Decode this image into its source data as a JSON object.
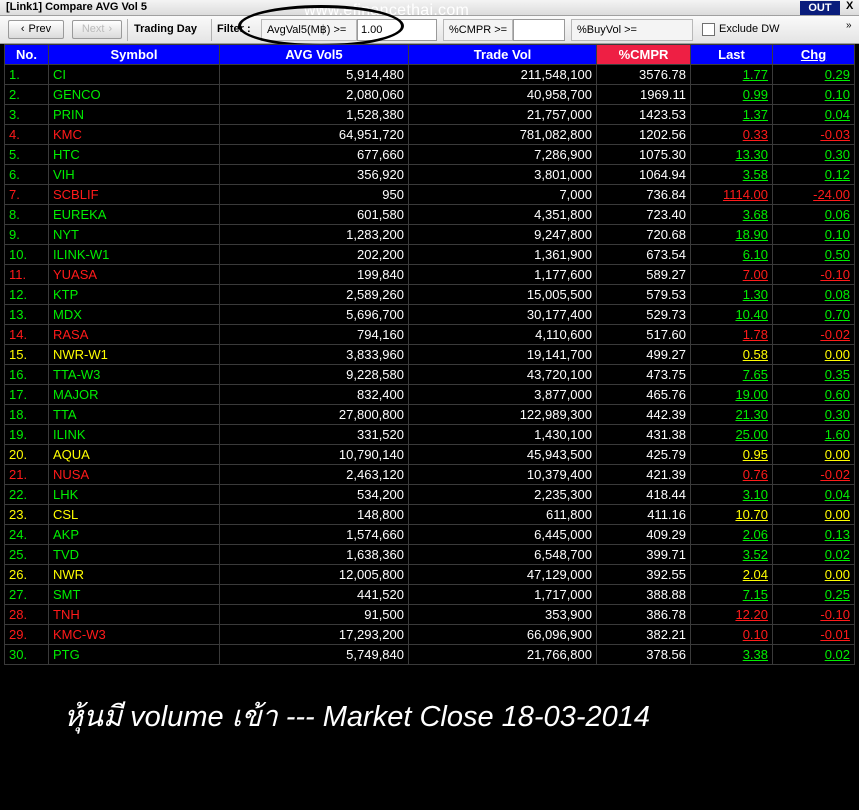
{
  "window": {
    "title": "[Link1] Compare AVG Vol 5",
    "watermark": "www.efinancethai.com",
    "out_label": "OUT",
    "close_label": "X"
  },
  "toolbar": {
    "prev_label": "Prev",
    "next_label": "Next",
    "trading_day_label": "Trading Day",
    "filter_label": "Filter :",
    "avgval_label": "AvgVal5(M฿) >=",
    "avgval_value": "1.00",
    "cmpr_label": "%CMPR >=",
    "cmpr_value": "",
    "buyvol_label": "%BuyVol >=",
    "exclude_label": "Exclude DW",
    "expand_label": "»"
  },
  "columns": [
    "No.",
    "Symbol",
    "AVG Vol5",
    "Trade Vol",
    "%CMPR",
    "Last",
    "Chg"
  ],
  "rows": [
    {
      "no": "1.",
      "symbol": "CI",
      "avg": "5,914,480",
      "vol": "211,548,100",
      "cmpr": "3576.78",
      "last": "1.77",
      "chg": "0.29",
      "color": "g"
    },
    {
      "no": "2.",
      "symbol": "GENCO",
      "avg": "2,080,060",
      "vol": "40,958,700",
      "cmpr": "1969.11",
      "last": "0.99",
      "chg": "0.10",
      "color": "g"
    },
    {
      "no": "3.",
      "symbol": "PRIN",
      "avg": "1,528,380",
      "vol": "21,757,000",
      "cmpr": "1423.53",
      "last": "1.37",
      "chg": "0.04",
      "color": "g"
    },
    {
      "no": "4.",
      "symbol": "KMC",
      "avg": "64,951,720",
      "vol": "781,082,800",
      "cmpr": "1202.56",
      "last": "0.33",
      "chg": "-0.03",
      "color": "r"
    },
    {
      "no": "5.",
      "symbol": "HTC",
      "avg": "677,660",
      "vol": "7,286,900",
      "cmpr": "1075.30",
      "last": "13.30",
      "chg": "0.30",
      "color": "g"
    },
    {
      "no": "6.",
      "symbol": "VIH",
      "avg": "356,920",
      "vol": "3,801,000",
      "cmpr": "1064.94",
      "last": "3.58",
      "chg": "0.12",
      "color": "g"
    },
    {
      "no": "7.",
      "symbol": "SCBLIF",
      "avg": "950",
      "vol": "7,000",
      "cmpr": "736.84",
      "last": "1114.00",
      "chg": "-24.00",
      "color": "r"
    },
    {
      "no": "8.",
      "symbol": "EUREKA",
      "avg": "601,580",
      "vol": "4,351,800",
      "cmpr": "723.40",
      "last": "3.68",
      "chg": "0.06",
      "color": "g"
    },
    {
      "no": "9.",
      "symbol": "NYT",
      "avg": "1,283,200",
      "vol": "9,247,800",
      "cmpr": "720.68",
      "last": "18.90",
      "chg": "0.10",
      "color": "g"
    },
    {
      "no": "10.",
      "symbol": "ILINK-W1",
      "avg": "202,200",
      "vol": "1,361,900",
      "cmpr": "673.54",
      "last": "6.10",
      "chg": "0.50",
      "color": "g"
    },
    {
      "no": "11.",
      "symbol": "YUASA",
      "avg": "199,840",
      "vol": "1,177,600",
      "cmpr": "589.27",
      "last": "7.00",
      "chg": "-0.10",
      "color": "r"
    },
    {
      "no": "12.",
      "symbol": "KTP",
      "avg": "2,589,260",
      "vol": "15,005,500",
      "cmpr": "579.53",
      "last": "1.30",
      "chg": "0.08",
      "color": "g"
    },
    {
      "no": "13.",
      "symbol": "MDX",
      "avg": "5,696,700",
      "vol": "30,177,400",
      "cmpr": "529.73",
      "last": "10.40",
      "chg": "0.70",
      "color": "g"
    },
    {
      "no": "14.",
      "symbol": "RASA",
      "avg": "794,160",
      "vol": "4,110,600",
      "cmpr": "517.60",
      "last": "1.78",
      "chg": "-0.02",
      "color": "r"
    },
    {
      "no": "15.",
      "symbol": "NWR-W1",
      "avg": "3,833,960",
      "vol": "19,141,700",
      "cmpr": "499.27",
      "last": "0.58",
      "chg": "0.00",
      "color": "y"
    },
    {
      "no": "16.",
      "symbol": "TTA-W3",
      "avg": "9,228,580",
      "vol": "43,720,100",
      "cmpr": "473.75",
      "last": "7.65",
      "chg": "0.35",
      "color": "g"
    },
    {
      "no": "17.",
      "symbol": "MAJOR",
      "avg": "832,400",
      "vol": "3,877,000",
      "cmpr": "465.76",
      "last": "19.00",
      "chg": "0.60",
      "color": "g"
    },
    {
      "no": "18.",
      "symbol": "TTA",
      "avg": "27,800,800",
      "vol": "122,989,300",
      "cmpr": "442.39",
      "last": "21.30",
      "chg": "0.30",
      "color": "g"
    },
    {
      "no": "19.",
      "symbol": "ILINK",
      "avg": "331,520",
      "vol": "1,430,100",
      "cmpr": "431.38",
      "last": "25.00",
      "chg": "1.60",
      "color": "g"
    },
    {
      "no": "20.",
      "symbol": "AQUA",
      "avg": "10,790,140",
      "vol": "45,943,500",
      "cmpr": "425.79",
      "last": "0.95",
      "chg": "0.00",
      "color": "y"
    },
    {
      "no": "21.",
      "symbol": "NUSA",
      "avg": "2,463,120",
      "vol": "10,379,400",
      "cmpr": "421.39",
      "last": "0.76",
      "chg": "-0.02",
      "color": "r"
    },
    {
      "no": "22.",
      "symbol": "LHK",
      "avg": "534,200",
      "vol": "2,235,300",
      "cmpr": "418.44",
      "last": "3.10",
      "chg": "0.04",
      "color": "g"
    },
    {
      "no": "23.",
      "symbol": "CSL",
      "avg": "148,800",
      "vol": "611,800",
      "cmpr": "411.16",
      "last": "10.70",
      "chg": "0.00",
      "color": "y"
    },
    {
      "no": "24.",
      "symbol": "AKP",
      "avg": "1,574,660",
      "vol": "6,445,000",
      "cmpr": "409.29",
      "last": "2.06",
      "chg": "0.13",
      "color": "g"
    },
    {
      "no": "25.",
      "symbol": "TVD",
      "avg": "1,638,360",
      "vol": "6,548,700",
      "cmpr": "399.71",
      "last": "3.52",
      "chg": "0.02",
      "color": "g"
    },
    {
      "no": "26.",
      "symbol": "NWR",
      "avg": "12,005,800",
      "vol": "47,129,000",
      "cmpr": "392.55",
      "last": "2.04",
      "chg": "0.00",
      "color": "y"
    },
    {
      "no": "27.",
      "symbol": "SMT",
      "avg": "441,520",
      "vol": "1,717,000",
      "cmpr": "388.88",
      "last": "7.15",
      "chg": "0.25",
      "color": "g"
    },
    {
      "no": "28.",
      "symbol": "TNH",
      "avg": "91,500",
      "vol": "353,900",
      "cmpr": "386.78",
      "last": "12.20",
      "chg": "-0.10",
      "color": "r"
    },
    {
      "no": "29.",
      "symbol": "KMC-W3",
      "avg": "17,293,200",
      "vol": "66,096,900",
      "cmpr": "382.21",
      "last": "0.10",
      "chg": "-0.01",
      "color": "r"
    },
    {
      "no": "30.",
      "symbol": "PTG",
      "avg": "5,749,840",
      "vol": "21,766,800",
      "cmpr": "378.56",
      "last": "3.38",
      "chg": "0.02",
      "color": "g"
    }
  ],
  "caption": "หุ้นมี volume เข้า --- Market Close 18-03-2014",
  "colors": {
    "up": "#00ee00",
    "down": "#ff1a1a",
    "unchanged": "#ffff00",
    "header": "#0000ff",
    "cmpr_header": "#ee1f44"
  }
}
